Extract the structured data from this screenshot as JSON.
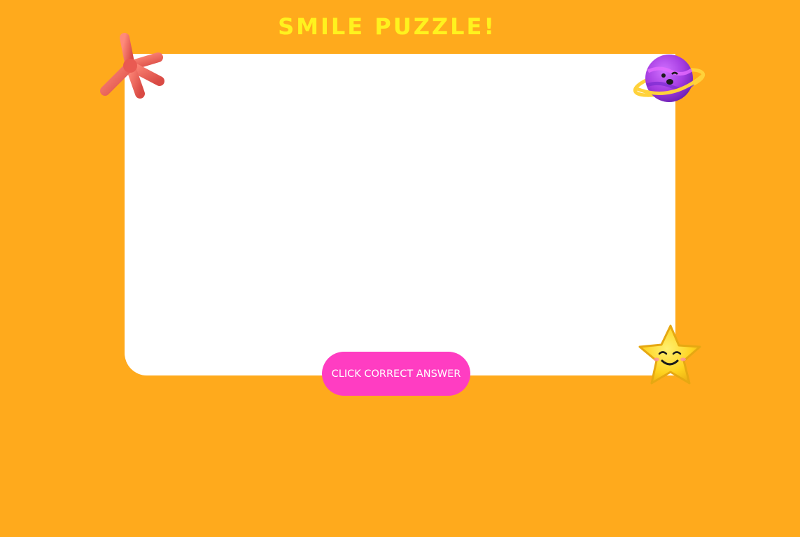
{
  "page": {
    "title": "SMILE PUZZLE!",
    "background_color": "#FFAA1C"
  },
  "board": {
    "background_color": "#FFFFFF"
  },
  "action": {
    "label": "CLICK CORRECT ANSWER",
    "color": "#FF3DC2"
  },
  "decorations": [
    {
      "name": "asterisk-icon",
      "color": "#F36A5F"
    },
    {
      "name": "planet-icon",
      "color": "#A43BE0"
    },
    {
      "name": "smiling-star-icon",
      "color": "#FFD21F"
    }
  ]
}
